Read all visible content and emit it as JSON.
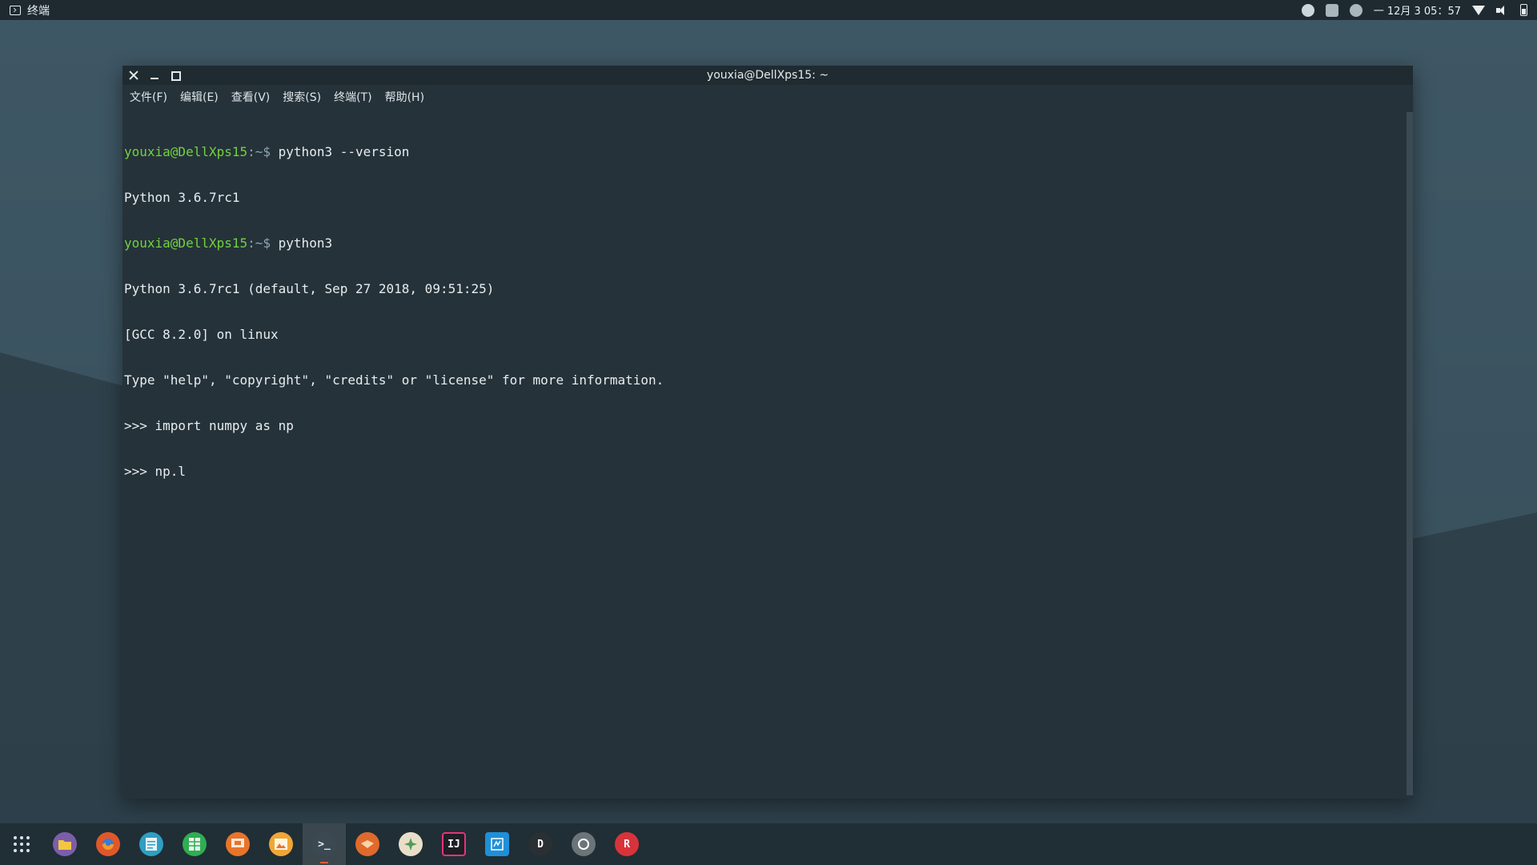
{
  "top_panel": {
    "app_name": "终端",
    "clock": "一 12月 3  05：57",
    "tray_icons": [
      "chef-hat-icon",
      "app-indicator-icon",
      "keyboard-icon",
      "wifi-icon",
      "volume-icon",
      "battery-icon"
    ]
  },
  "window": {
    "title": "youxia@DellXps15: ~",
    "controls": [
      "close-icon",
      "minimize-icon",
      "maximize-icon"
    ],
    "menu": [
      "文件(F)",
      "编辑(E)",
      "查看(V)",
      "搜索(S)",
      "终端(T)",
      "帮助(H)"
    ]
  },
  "terminal": {
    "line1_user": "youxia@DellXps15",
    "line1_path": ":~$ ",
    "line1_cmd": "python3 --version",
    "line2": "Python 3.6.7rc1",
    "line3_user": "youxia@DellXps15",
    "line3_path": ":~$ ",
    "line3_cmd": "python3",
    "line4": "Python 3.6.7rc1 (default, Sep 27 2018, 09:51:25)",
    "line5": "[GCC 8.2.0] on linux",
    "line6": "Type \"help\", \"copyright\", \"credits\" or \"license\" for more information.",
    "line7": ">>> import numpy as np",
    "line8": ">>> np.l"
  },
  "dock": {
    "items": [
      {
        "name": "app-launcher",
        "icon": "grid-icon"
      },
      {
        "name": "files",
        "icon": "folder-icon",
        "color": "#7a5fa8"
      },
      {
        "name": "firefox",
        "icon": "firefox-icon",
        "color": "#e0582a"
      },
      {
        "name": "text-editor",
        "icon": "document-icon",
        "color": "#2e9fc2"
      },
      {
        "name": "spreadsheet",
        "icon": "spreadsheet-icon",
        "color": "#2fae52"
      },
      {
        "name": "presentation",
        "icon": "presentation-icon",
        "color": "#e8742a"
      },
      {
        "name": "image-viewer",
        "icon": "image-icon",
        "color": "#f0a636"
      },
      {
        "name": "terminal",
        "icon": "terminal-icon",
        "color": "#3b4a52",
        "active": true
      },
      {
        "name": "package-manager",
        "icon": "package-icon",
        "color": "#e06a2c"
      },
      {
        "name": "settings-app",
        "icon": "star-icon",
        "color": "#e9dfc8"
      },
      {
        "name": "intellij",
        "icon": "intellij-icon",
        "color": "#1d1f24"
      },
      {
        "name": "vscode-like",
        "icon": "code-icon",
        "color": "#1f8fd8"
      },
      {
        "name": "d-app",
        "icon": "d-icon",
        "color": "#2a2f33"
      },
      {
        "name": "chromium",
        "icon": "circle-icon",
        "color": "#6b7478"
      },
      {
        "name": "r-app",
        "icon": "r-icon",
        "color": "#d8333a"
      }
    ]
  },
  "colors": {
    "prompt_user": "#72d33c",
    "terminal_bg": "#25323a",
    "panel_bg": "#1e2a30"
  }
}
